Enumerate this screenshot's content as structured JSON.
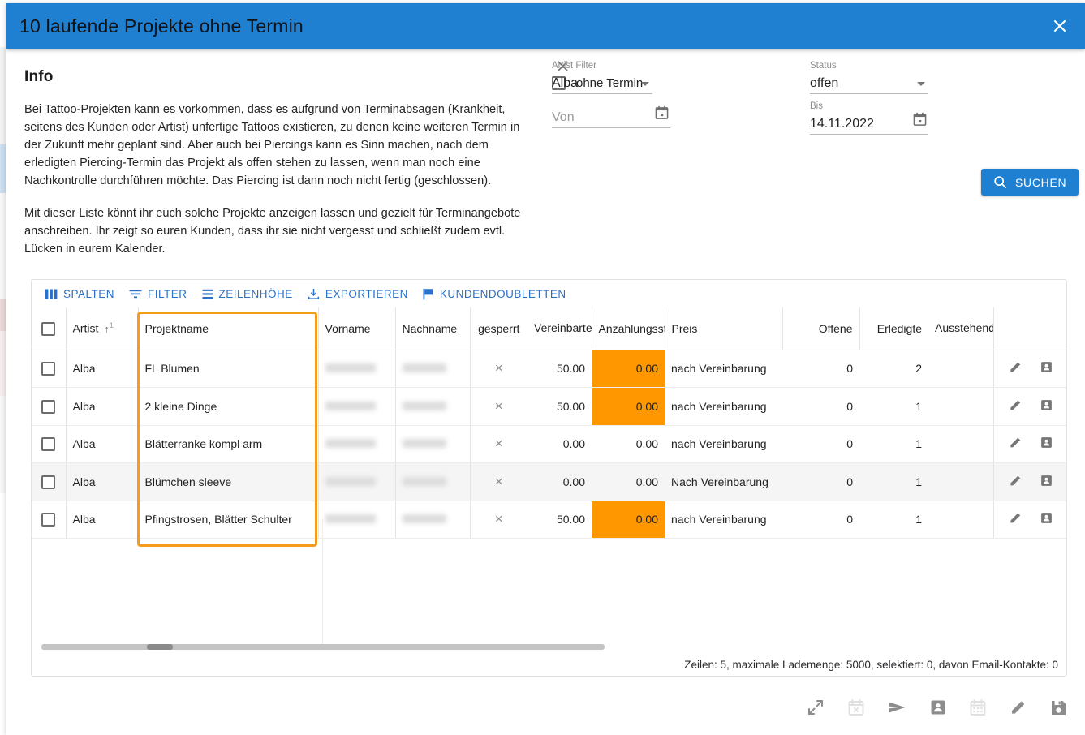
{
  "window": {
    "title": "10 laufende Projekte ohne Termin",
    "close_label": "×",
    "accent_blue": "#1f7fd0",
    "accent_orange": "#ff9800",
    "highlight_orange": "#f79c1a"
  },
  "info": {
    "heading": "Info",
    "paragraph1": "Bei Tattoo-Projekten kann es vorkommen, dass es aufgrund von Terminabsagen (Krankheit, seitens des Kunden oder Artist) unfertige Tattoos existieren, zu denen keine weiteren Termin in der Zukunft mehr geplant sind. Aber auch bei Piercings kann es Sinn machen, nach dem erledigten Piercing-Termin das Projekt als offen stehen zu lassen, wenn man noch eine Nachkontrolle durchführen möchte. Das Piercing ist dann noch nicht fertig (geschlossen).",
    "paragraph2": "Mit dieser Liste könnt ihr euch solche Projekte anzeigen lassen und gezielt für Terminangebote anschreiben. Ihr zeigt so euren Kunden, dass ihr sie nicht vergesst und schließt zudem evtl. Lücken in eurem Kalender."
  },
  "filters": {
    "artist": {
      "label": "Artist Filter",
      "value": "Alba",
      "clear_icon": "close-icon"
    },
    "von": {
      "label": "",
      "value": "",
      "placeholder": "Von",
      "icon": "calendar-icon"
    },
    "ohne_termin": {
      "label": "ohne Termin",
      "checked": false
    },
    "status": {
      "label": "Status",
      "value": "offen"
    },
    "bis": {
      "label": "Bis",
      "value": "14.11.2022",
      "icon": "calendar-icon"
    },
    "search_button": {
      "label": "SUCHEN",
      "icon": "search-icon"
    }
  },
  "grid_toolbar": [
    {
      "label": "SPALTEN",
      "icon": "columns-icon"
    },
    {
      "label": "FILTER",
      "icon": "filter-icon"
    },
    {
      "label": "ZEILENHÖHE",
      "icon": "row-height-icon"
    },
    {
      "label": "EXPORTIEREN",
      "icon": "download-icon"
    },
    {
      "label": "KUNDENDOUBLETTEN",
      "icon": "flag-icon"
    }
  ],
  "table": {
    "headers": {
      "select": "",
      "artist": "Artist",
      "artist_sort": "↑",
      "artist_badge": "1",
      "projektname": "Projektname",
      "vorname": "Vorname",
      "nachname": "Nachname",
      "gesperrt": "gesperrt",
      "vereinbarte_anzahlung": "Vereinbarte Anzahlung",
      "anzahlungsst": "Anzahlungsst",
      "preis": "Preis",
      "offene": "Offene",
      "erledigte": "Erledigte",
      "ausstehende_termine": "Ausstehend Termine"
    },
    "rows": [
      {
        "artist": "Alba",
        "projektname": "FL Blumen",
        "vorname": "",
        "nachname": "",
        "gesperrt": "×",
        "vereinbarte_anzahlung": "50.00",
        "anzahlungsst": "0.00",
        "anzahlung_highlight": true,
        "preis": "nach Vereinbarung",
        "offene": "0",
        "erledigte": "2",
        "ausstehende_termine": "",
        "alt": false
      },
      {
        "artist": "Alba",
        "projektname": "2 kleine Dinge",
        "vorname": "",
        "nachname": "",
        "gesperrt": "×",
        "vereinbarte_anzahlung": "50.00",
        "anzahlungsst": "0.00",
        "anzahlung_highlight": true,
        "preis": "nach Vereinbarung",
        "offene": "0",
        "erledigte": "1",
        "ausstehende_termine": "",
        "alt": false
      },
      {
        "artist": "Alba",
        "projektname": "Blätterranke kompl arm",
        "vorname": "",
        "nachname": "",
        "gesperrt": "×",
        "vereinbarte_anzahlung": "0.00",
        "anzahlungsst": "0.00",
        "anzahlung_highlight": false,
        "preis": "nach Vereinbarung",
        "offene": "0",
        "erledigte": "1",
        "ausstehende_termine": "",
        "alt": false
      },
      {
        "artist": "Alba",
        "projektname": "Blümchen sleeve",
        "vorname": "",
        "nachname": "",
        "gesperrt": "×",
        "vereinbarte_anzahlung": "0.00",
        "anzahlungsst": "0.00",
        "anzahlung_highlight": false,
        "preis": "Nach Vereinbarung",
        "offene": "0",
        "erledigte": "1",
        "ausstehende_termine": "",
        "alt": true
      },
      {
        "artist": "Alba",
        "projektname": "Pfingstrosen, Blätter Schulter",
        "vorname": "",
        "nachname": "",
        "gesperrt": "×",
        "vereinbarte_anzahlung": "50.00",
        "anzahlungsst": "0.00",
        "anzahlung_highlight": true,
        "preis": "nach Vereinbarung",
        "offene": "0",
        "erledigte": "1",
        "ausstehende_termine": "",
        "alt": false
      }
    ],
    "row_action_icons": [
      "edit-icon",
      "contact-icon"
    ],
    "footer_status": "Zeilen: 5,  maximale Lademenge: 5000, selektiert: 0, davon Email-Kontakte: 0"
  },
  "bottom_actions": [
    {
      "name": "expand-icon",
      "enabled": true
    },
    {
      "name": "calendar-cancel-icon",
      "enabled": false
    },
    {
      "name": "send-icon",
      "enabled": true
    },
    {
      "name": "contact-icon",
      "enabled": true
    },
    {
      "name": "calendar-icon",
      "enabled": false
    },
    {
      "name": "edit-icon",
      "enabled": true
    },
    {
      "name": "save-icon",
      "enabled": true
    }
  ]
}
